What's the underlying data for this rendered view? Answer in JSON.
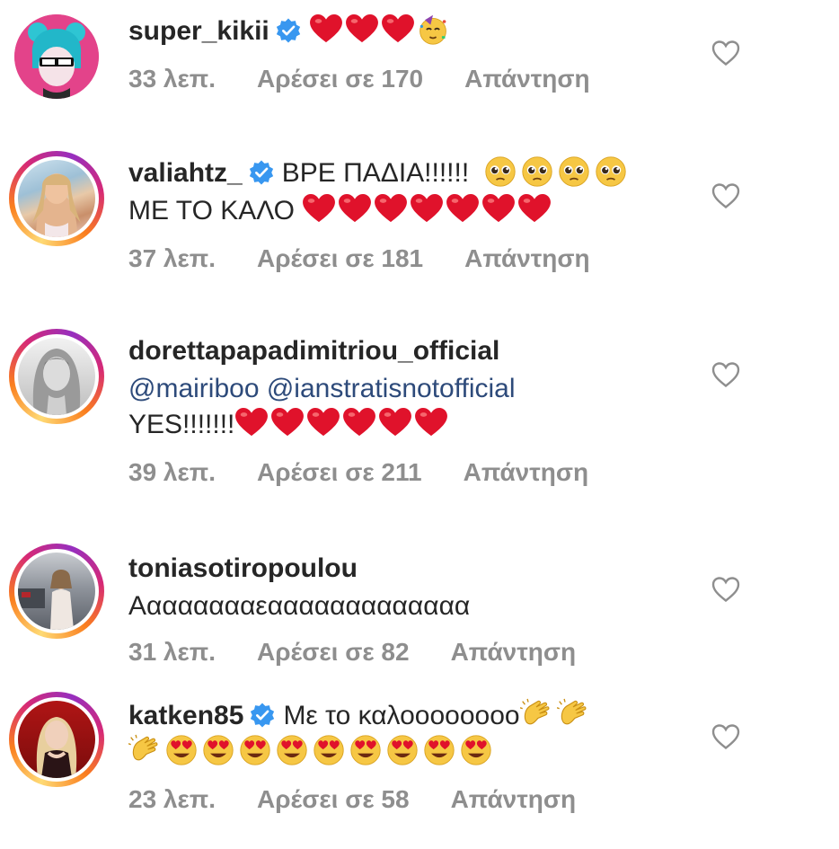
{
  "comments": [
    {
      "username": "super_kikii",
      "verified": true,
      "text_lines": [
        "",
        ""
      ],
      "emoji_line1": "❤️❤️❤️🥳",
      "time": "33 λεπ.",
      "likes": "Αρέσει σε 170",
      "reply": "Απάντηση",
      "avatar": "cartoon-avatar"
    },
    {
      "username": "valiahtz_",
      "verified": true,
      "text_line1": "ΒΡΕ ΠΑΔΙΑ!!!!!!",
      "emoji_line1": "🥹🥹🥹🥹",
      "text_line2": "ΜΕ ΤΟ ΚΑΛΟ",
      "emoji_line2": "❤️❤️❤️❤️❤️❤️❤️",
      "time": "37 λεπ.",
      "likes": "Αρέσει σε 181",
      "reply": "Απάντηση",
      "avatar": "photo-avatar"
    },
    {
      "username": "dorettapapadimitriou_official",
      "verified": false,
      "mentions": "@mairiboo @ianstratisnotofficial",
      "text_line2": "YES!!!!!!!",
      "emoji_line2": "❤️❤️❤️❤️❤️❤️",
      "time": "39 λεπ.",
      "likes": "Αρέσει σε 211",
      "reply": "Απάντηση",
      "avatar": "photo-avatar"
    },
    {
      "username": "toniasotiropoulou",
      "verified": false,
      "text_line1": "Ααααααααεααααααααααααα",
      "time": "31 λεπ.",
      "likes": "Αρέσει σε 82",
      "reply": "Απάντηση",
      "avatar": "photo-avatar"
    },
    {
      "username": "katken85",
      "verified": true,
      "text_line1": "Με το καλοοοοοοοο",
      "emoji_line1": "👏👏",
      "emoji_line2": "👏😍😍😍😍😍😍😍😍😍",
      "time": "23 λεπ.",
      "likes": "Αρέσει σε 58",
      "reply": "Απάντηση",
      "avatar": "photo-avatar"
    }
  ],
  "icons": {
    "verified": "verified-badge-icon",
    "like": "heart-outline-icon"
  },
  "colors": {
    "verified_blue": "#3897f0",
    "heart_red": "#e0122b",
    "meta_gray": "#8e8e8e",
    "mention_blue": "#2d4a7a"
  }
}
